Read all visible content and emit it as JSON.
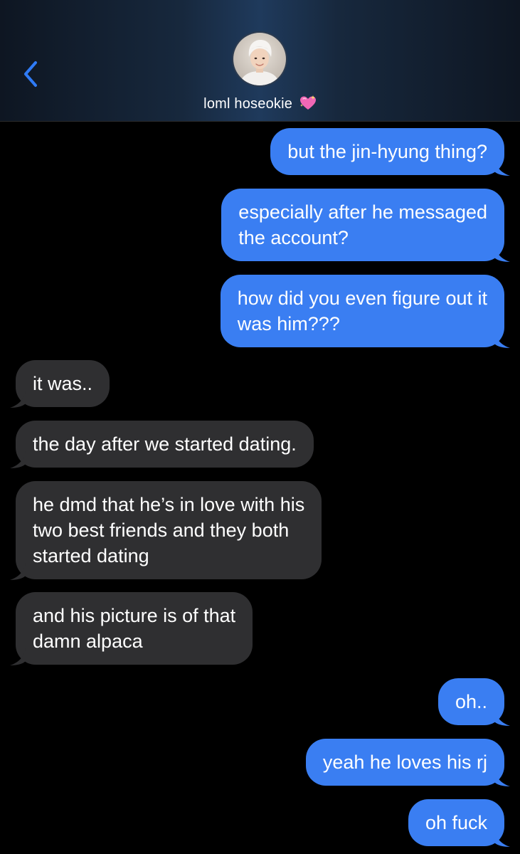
{
  "header": {
    "contact_name": "loml hoseokie",
    "name_emoji": "sparkling-heart-icon",
    "back_icon": "chevron-left-icon"
  },
  "colors": {
    "outgoing_bubble": "#3a7ef2",
    "incoming_bubble": "#2f2f31",
    "accent": "#2f7bf6",
    "background": "#000000"
  },
  "messages": [
    {
      "dir": "out",
      "text": "but the jin-hyung thing?"
    },
    {
      "dir": "out",
      "text": "especially after he messaged\nthe account?"
    },
    {
      "dir": "out",
      "text": "how did you even figure out it\nwas him???"
    },
    {
      "dir": "in",
      "text": "it was.."
    },
    {
      "dir": "in",
      "text": "the day after we started dating."
    },
    {
      "dir": "in",
      "text": "he dmd that he’s in love with his\ntwo best friends and they both\nstarted dating"
    },
    {
      "dir": "in",
      "text": "and his picture is of that\ndamn alpaca"
    },
    {
      "dir": "out",
      "text": "oh.."
    },
    {
      "dir": "out",
      "text": "yeah he loves his rj"
    },
    {
      "dir": "out",
      "text": "oh fuck"
    }
  ]
}
